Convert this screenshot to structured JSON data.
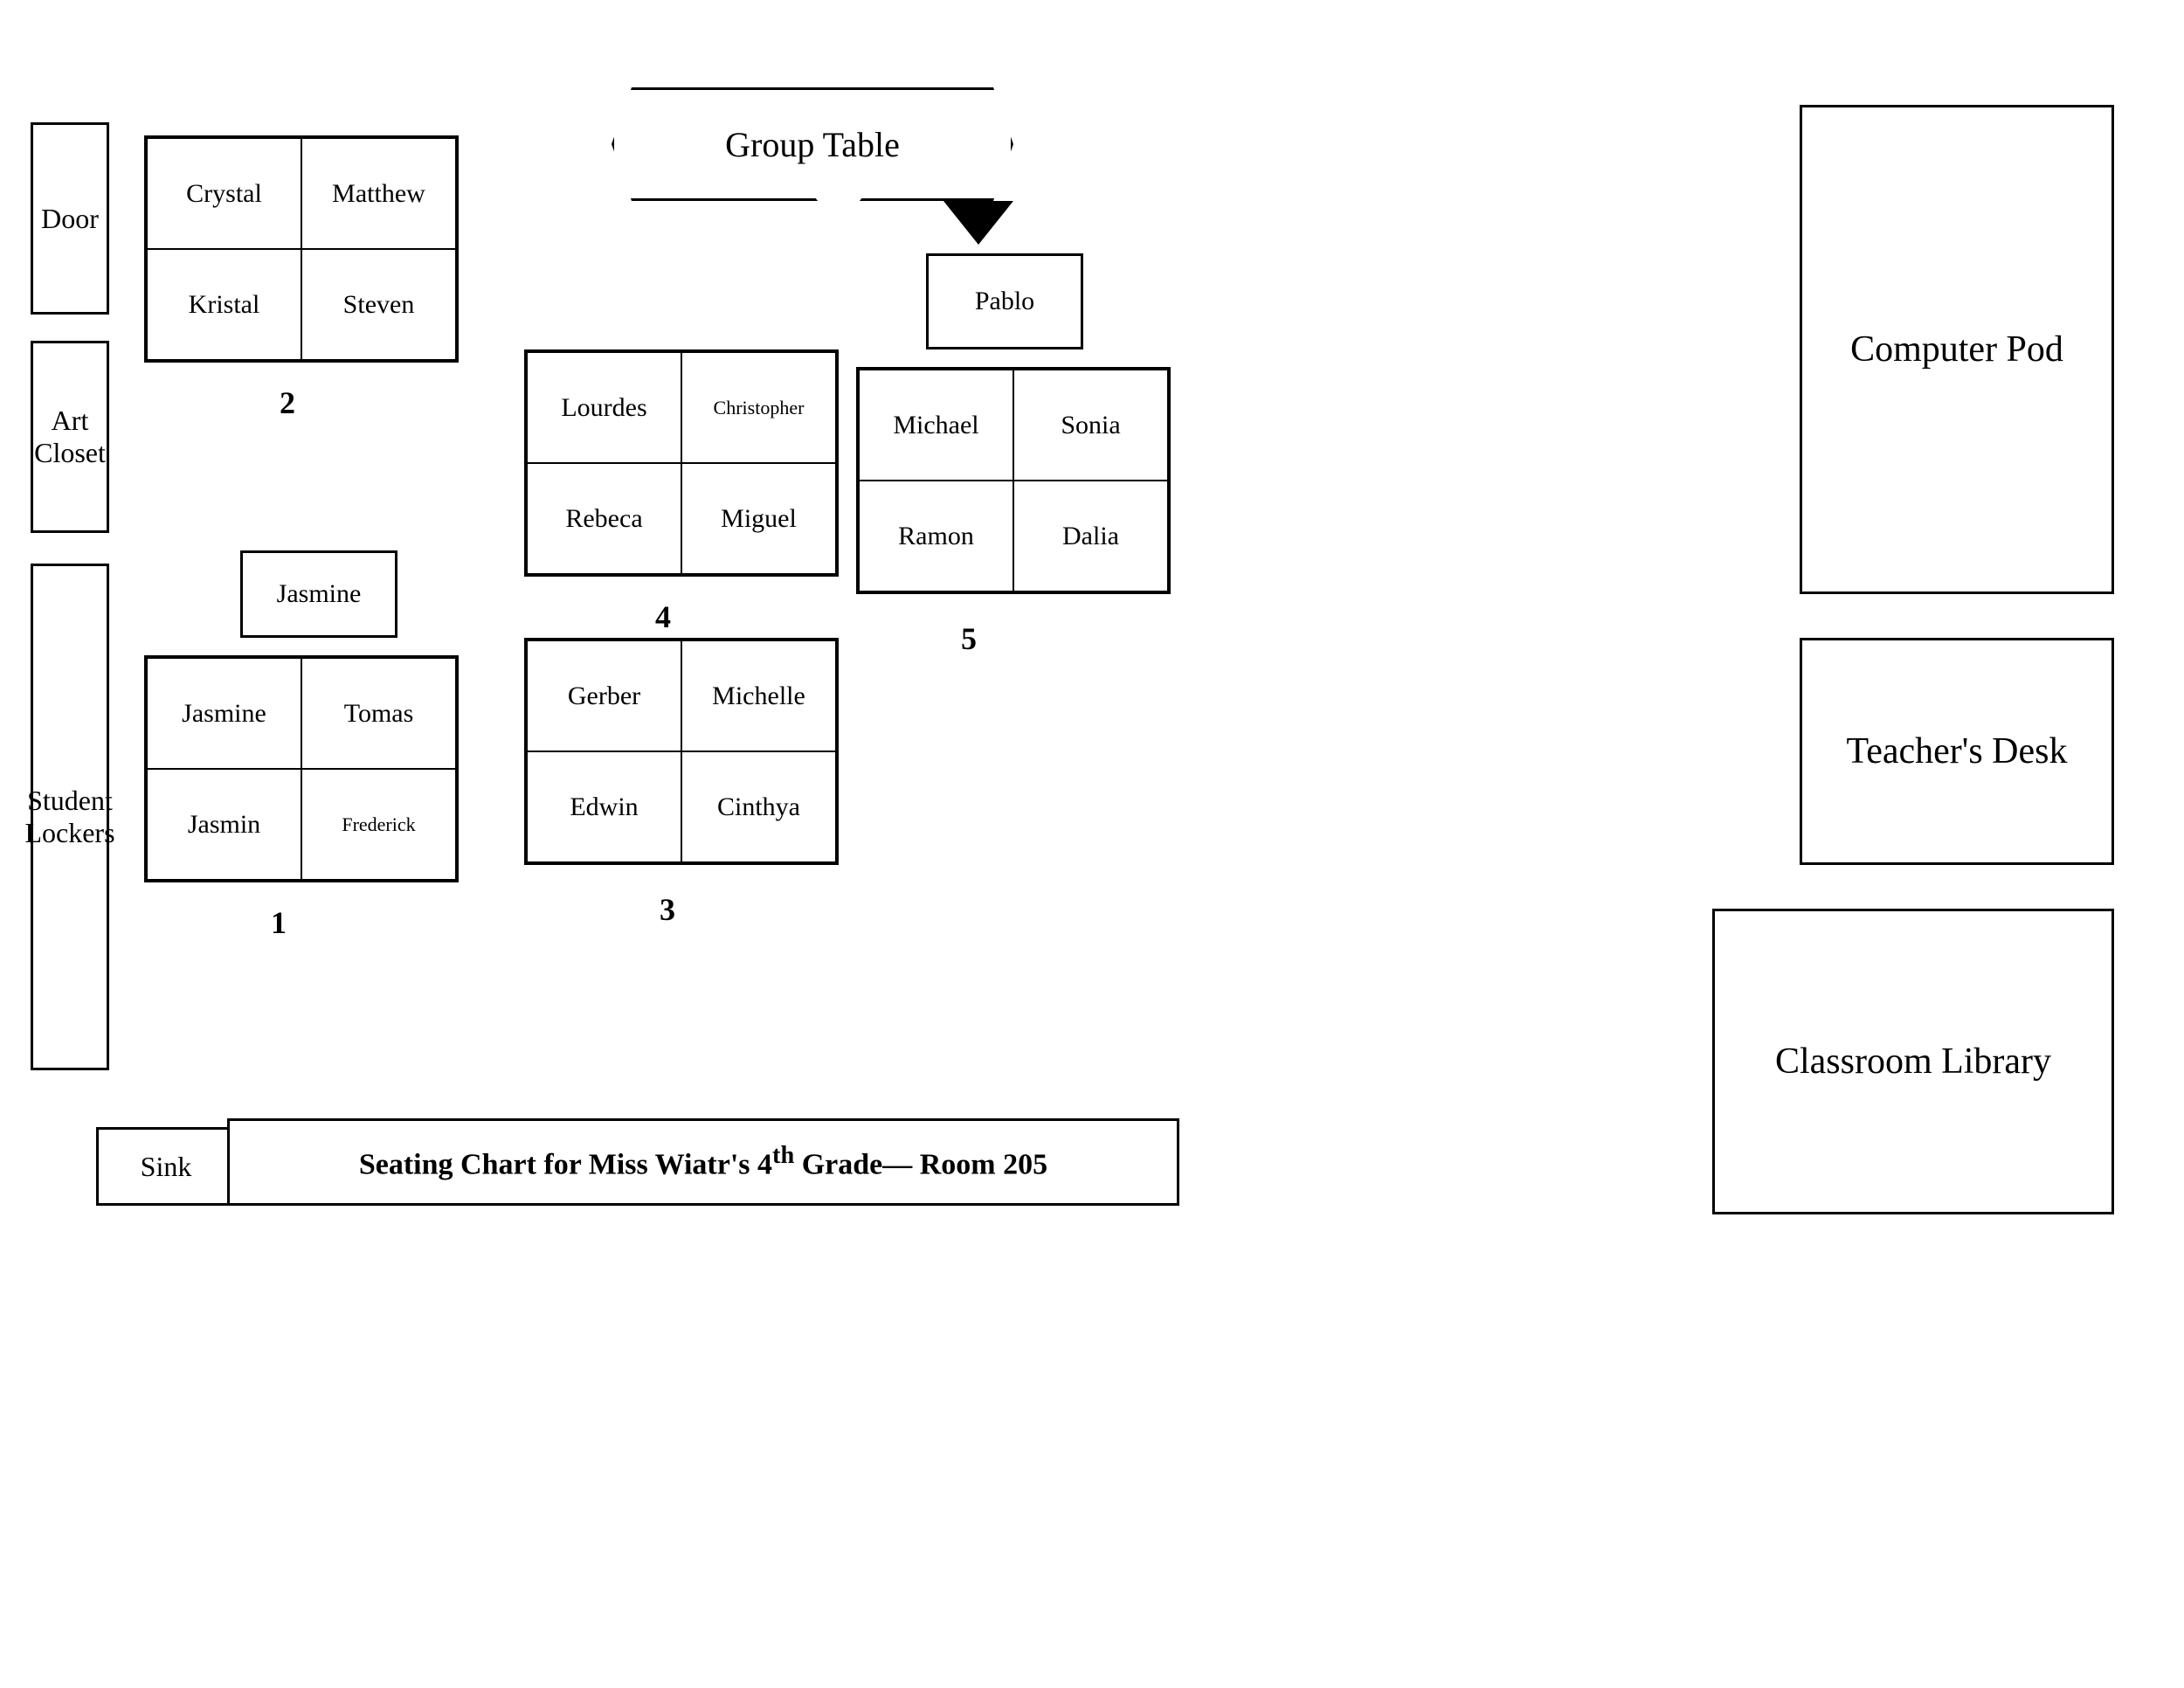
{
  "layout": {
    "title": "Seating Chart for Miss Wiatr's 4th Grade— Room 205",
    "grade_superscript": "th"
  },
  "labels": {
    "door": "Door",
    "art_closet": "Art Closet",
    "student_lockers": "Student Lockers",
    "sink": "Sink",
    "computer_pod": "Computer Pod",
    "teachers_desk": "Teacher's Desk",
    "classroom_library": "Classroom Library",
    "group_table": "Group Table"
  },
  "groups": {
    "group1": {
      "number": "1",
      "jasmine_single": "Jasmine",
      "seats": [
        "Jasmine",
        "Tomas",
        "Jasmin",
        "Frederick"
      ]
    },
    "group2": {
      "number": "2",
      "seats": [
        "Crystal",
        "Matthew",
        "Kristal",
        "Steven"
      ]
    },
    "group3": {
      "number": "3",
      "seats": [
        "Gerber",
        "Michelle",
        "Edwin",
        "Cinthya"
      ]
    },
    "group4": {
      "number": "4",
      "seats": [
        "Lourdes",
        "Christopher",
        "Rebeca",
        "Miguel"
      ]
    },
    "group5": {
      "number": "5",
      "pablo": "Pablo",
      "seats": [
        "Michael",
        "Sonia",
        "Ramon",
        "Dalia"
      ]
    }
  }
}
